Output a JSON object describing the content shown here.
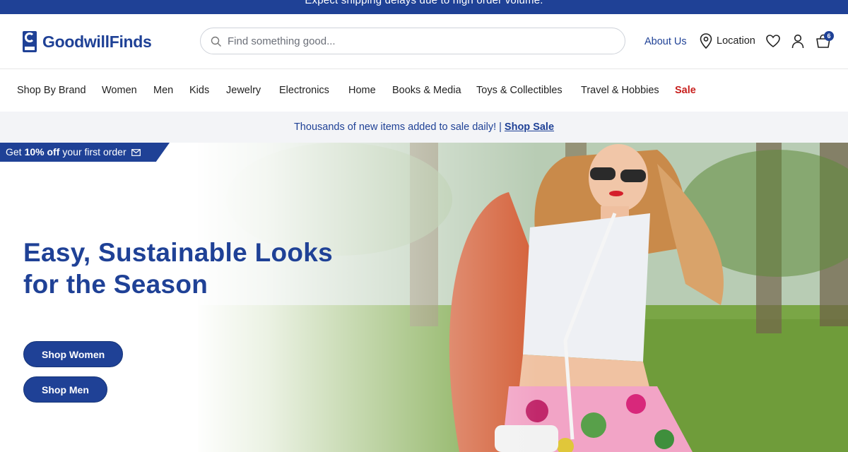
{
  "announcement": "Expect shipping delays due to high order volume.",
  "brand": {
    "name": "GoodwillFinds",
    "color": "#1f4196"
  },
  "search": {
    "placeholder": "Find something good...",
    "icon": "search-icon"
  },
  "header_links": {
    "about": "About Us",
    "location": "Location"
  },
  "header_icons": [
    "location-pin-icon",
    "heart-icon",
    "user-icon",
    "cart-icon"
  ],
  "cart": {
    "count": "6"
  },
  "categories": [
    {
      "label": "Shop By Brand"
    },
    {
      "label": "Women"
    },
    {
      "label": "Men"
    },
    {
      "label": "Kids"
    },
    {
      "label": "Jewelry"
    },
    {
      "label": "Electronics"
    },
    {
      "label": "Home"
    },
    {
      "label": "Books & Media"
    },
    {
      "label": "Toys & Collectibles"
    },
    {
      "label": "Travel & Hobbies"
    },
    {
      "label": "Sale",
      "color": "#c8201e"
    }
  ],
  "sale_banner": {
    "text": "Thousands of new items added to sale daily! | ",
    "link": "Shop Sale"
  },
  "promo": {
    "prefix": "Get",
    "highlight": "10% off",
    "suffix": "your first order",
    "icon": "mail-icon"
  },
  "hero": {
    "title": "Easy, Sustainable Looks for the Season",
    "buttons": [
      "Shop Women",
      "Shop Men"
    ]
  }
}
